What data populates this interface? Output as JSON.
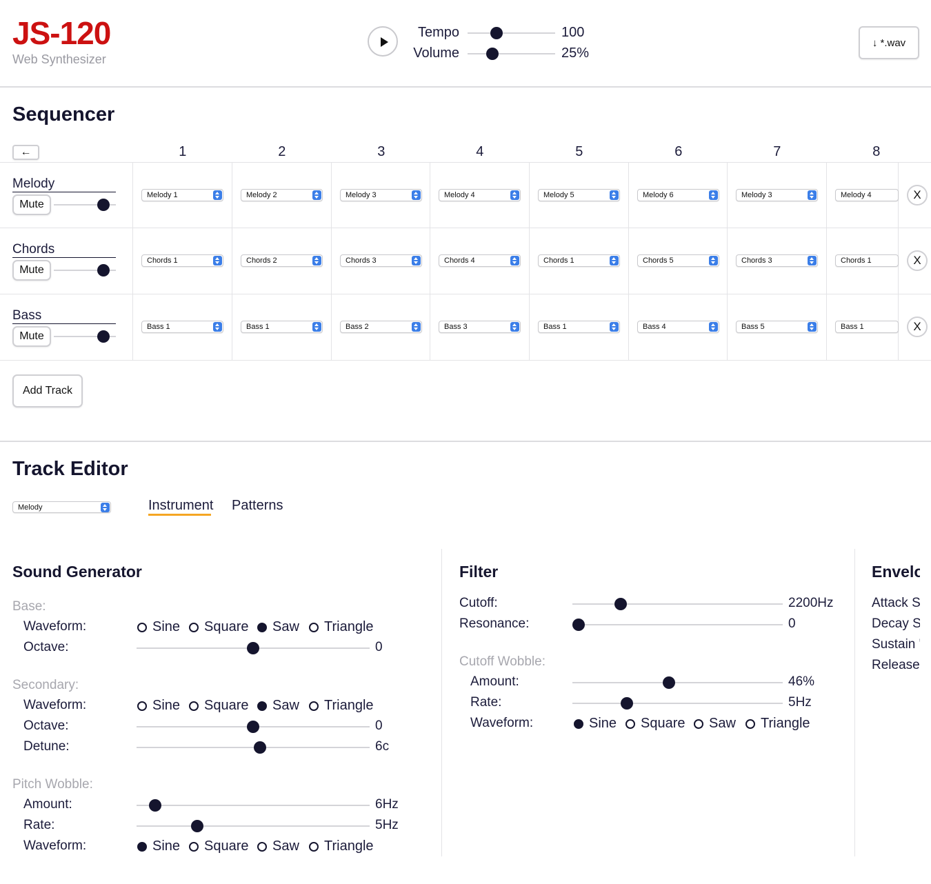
{
  "header": {
    "title": "JS-120",
    "subtitle": "Web Synthesizer",
    "tempo_label": "Tempo",
    "tempo_value": "100",
    "tempo_level": 0.33,
    "volume_label": "Volume",
    "volume_value": "25%",
    "volume_level": 0.28,
    "download_label": "↓  *.wav"
  },
  "sequencer": {
    "title": "Sequencer",
    "back_label": "←",
    "columns": [
      "1",
      "2",
      "3",
      "4",
      "5",
      "6",
      "7",
      "8"
    ],
    "tracks": [
      {
        "name": "Melody",
        "mute": "Mute",
        "level": 0.8,
        "patterns": [
          "Melody 1",
          "Melody 2",
          "Melody 3",
          "Melody 4",
          "Melody 5",
          "Melody 6",
          "Melody 3",
          "Melody 4"
        ],
        "remove": "X"
      },
      {
        "name": "Chords",
        "mute": "Mute",
        "level": 0.8,
        "patterns": [
          "Chords 1",
          "Chords 2",
          "Chords 3",
          "Chords 4",
          "Chords 1",
          "Chords 5",
          "Chords 3",
          "Chords 1"
        ],
        "remove": "X"
      },
      {
        "name": "Bass",
        "mute": "Mute",
        "level": 0.8,
        "patterns": [
          "Bass 1",
          "Bass 1",
          "Bass 2",
          "Bass 3",
          "Bass 1",
          "Bass 4",
          "Bass 5",
          "Bass 1"
        ],
        "remove": "X"
      }
    ],
    "add_track": "Add Track"
  },
  "editor": {
    "title": "Track Editor",
    "track_select": "Melody",
    "tabs": [
      {
        "label": "Instrument",
        "active": true
      },
      {
        "label": "Patterns",
        "active": false
      }
    ],
    "accent_color": "#f5a623"
  },
  "sound_generator": {
    "title": "Sound Generator",
    "base_label": "Base:",
    "base_waveform_label": "Waveform:",
    "base_waveform": "Saw",
    "base_octave_label": "Octave:",
    "base_octave_value": "0",
    "base_octave_level": 0.5,
    "secondary_label": "Secondary:",
    "sec_waveform_label": "Waveform:",
    "sec_waveform": "Saw",
    "sec_octave_label": "Octave:",
    "sec_octave_value": "0",
    "sec_octave_level": 0.5,
    "sec_detune_label": "Detune:",
    "sec_detune_value": "6c",
    "sec_detune_level": 0.53,
    "pitch_label": "Pitch Wobble:",
    "pitch_amount_label": "Amount:",
    "pitch_amount_value": "6Hz",
    "pitch_amount_level": 0.08,
    "pitch_rate_label": "Rate:",
    "pitch_rate_value": "5Hz",
    "pitch_rate_level": 0.26,
    "pitch_waveform_label": "Waveform:",
    "pitch_waveform": "Sine",
    "waveforms": [
      "Sine",
      "Square",
      "Saw",
      "Triangle"
    ]
  },
  "filter": {
    "title": "Filter",
    "cutoff_label": "Cutoff:",
    "cutoff_value": "2200Hz",
    "cutoff_level": 0.23,
    "resonance_label": "Resonance:",
    "resonance_value": "0",
    "resonance_level": 0.03,
    "wobble_label": "Cutoff Wobble:",
    "amount_label": "Amount:",
    "amount_value": "46%",
    "amount_level": 0.46,
    "rate_label": "Rate:",
    "rate_value": "5Hz",
    "rate_level": 0.26,
    "waveform_label": "Waveform:",
    "waveform": "Sine"
  },
  "envelope": {
    "title": "Envelo",
    "items": [
      "Attack S",
      "Decay S",
      "Sustain '",
      "Release"
    ]
  }
}
